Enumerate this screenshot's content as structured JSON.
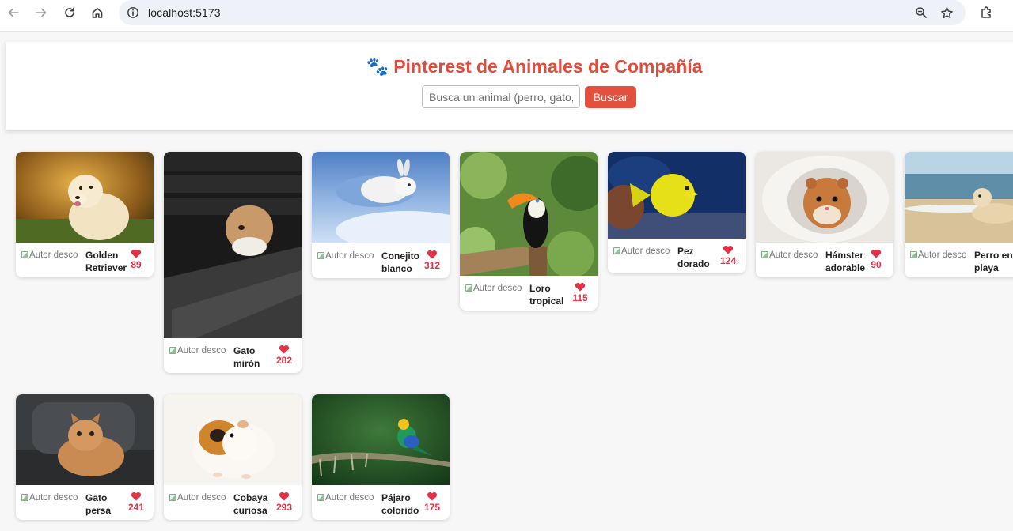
{
  "browser": {
    "url": "localhost:5173",
    "icons": [
      "back-arrow-icon",
      "forward-arrow-icon",
      "reload-icon",
      "home-icon",
      "site-info-icon",
      "zoom-icon",
      "bookmark-star-icon",
      "extensions-icon"
    ]
  },
  "header": {
    "paw": "🐾",
    "title": "Pinterest de Animales de Compañía",
    "search_placeholder": "Busca un animal (perro, gato, loro...)",
    "search_button": "Buscar",
    "accent_color": "#e14b3b"
  },
  "pins": [
    {
      "author": "Autor desconocido",
      "title": "Golden Retriever",
      "likes": "89",
      "image": "golden-retriever"
    },
    {
      "author": "Autor desconocido",
      "title": "Gato mirón",
      "likes": "282",
      "image": "cat-peeking"
    },
    {
      "author": "Autor desconocido",
      "title": "Conejito blanco",
      "likes": "312",
      "image": "white-rabbit-snow"
    },
    {
      "author": "Autor desconocido",
      "title": "Loro tropical",
      "likes": "115",
      "image": "toucan"
    },
    {
      "author": "Autor desconocido",
      "title": "Pez dorado",
      "likes": "124",
      "image": "yellow-fish"
    },
    {
      "author": "Autor desconocido",
      "title": "Hámster adorable",
      "likes": "90",
      "image": "hamster"
    },
    {
      "author": "Autor desconocido",
      "title": "Perro en playa",
      "likes": "",
      "image": "dog-on-beach"
    },
    {
      "author": "Autor desconocido",
      "title": "Gato persa",
      "likes": "241",
      "image": "persian-cat"
    },
    {
      "author": "Autor desconocido",
      "title": "Cobaya curiosa",
      "likes": "293",
      "image": "guinea-pig"
    },
    {
      "author": "Autor desconocido",
      "title": "Pájaro colorido",
      "likes": "175",
      "image": "colorful-bird"
    }
  ]
}
